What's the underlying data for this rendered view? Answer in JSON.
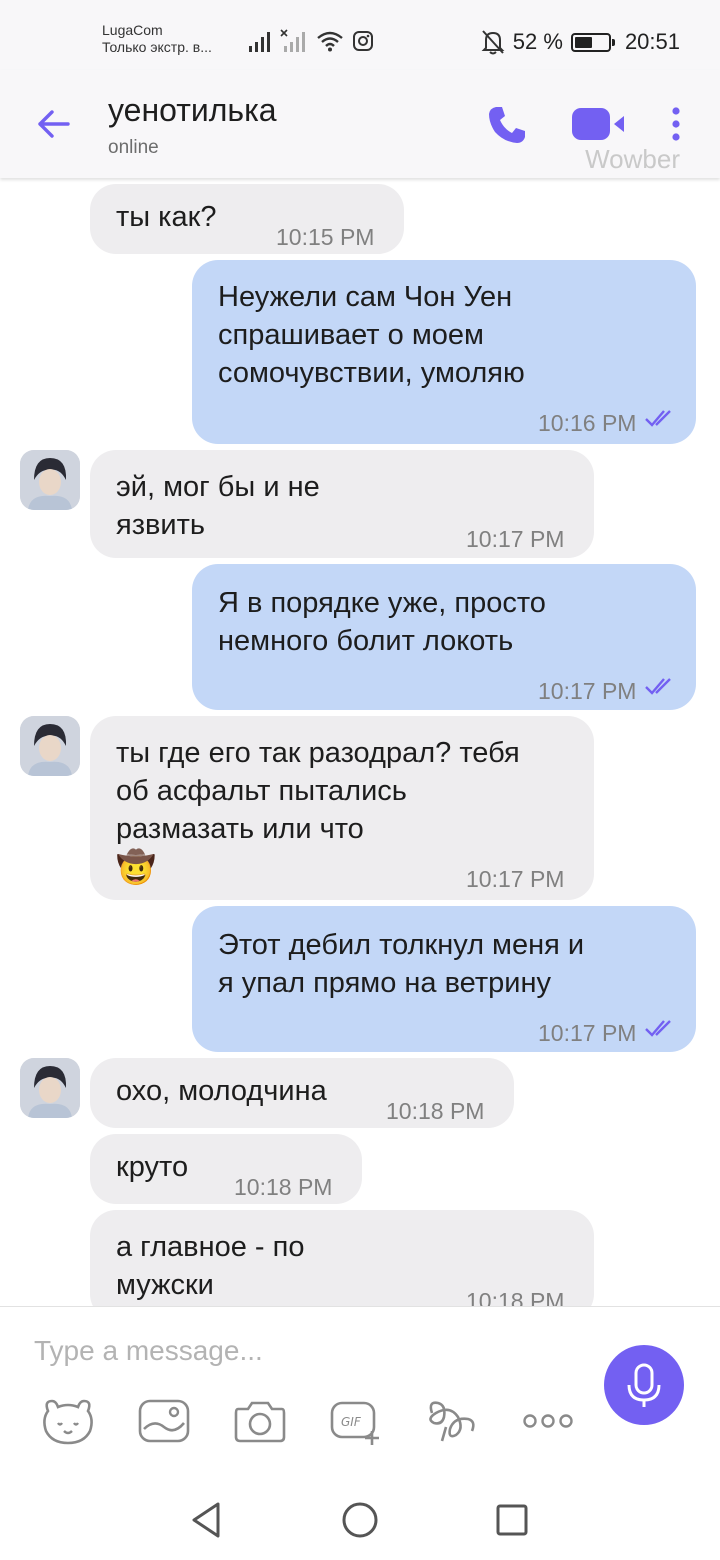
{
  "status_bar": {
    "carrier": "LugaCom",
    "carrier_sub": "Только экстр. в...",
    "battery_text": "52 %",
    "battery_level": 0.52,
    "time": "20:51"
  },
  "header": {
    "back_icon": "arrow-left-icon",
    "name": "уенотилька",
    "status": "online",
    "watermark": "Wowber",
    "accent_color": "#7360f2"
  },
  "messages": [
    {
      "dir": "in",
      "text": "ты как?",
      "time": "10:15 PM"
    },
    {
      "dir": "out",
      "text": "Неужели сам Чон Уен спрашивает о моем сомочувствии, умоляю",
      "time": "10:16 PM"
    },
    {
      "dir": "in",
      "text": "эй, мог бы и не язвить",
      "time": "10:17 PM"
    },
    {
      "dir": "out",
      "text": "Я в порядке уже, просто немного болит локоть",
      "time": "10:17 PM"
    },
    {
      "dir": "in",
      "text": "ты где его так разодрал? тебя об асфальт пытались размазать или что",
      "emoji": "🤠",
      "time": "10:17 PM"
    },
    {
      "dir": "out",
      "text": "Этот дебил толкнул меня и я упал прямо на ветрину",
      "time": "10:17 PM"
    },
    {
      "dir": "in",
      "text": "охо, молодчина",
      "time": "10:18 PM"
    },
    {
      "dir": "in",
      "text": "круто",
      "time": "10:18 PM"
    },
    {
      "dir": "in",
      "text": "а главное - по мужски",
      "time": "10:18 PM"
    }
  ],
  "composer": {
    "placeholder": "Type a message...",
    "mic_icon": "microphone-icon",
    "tools": [
      "sticker-icon",
      "gallery-icon",
      "camera-icon",
      "gif-icon",
      "doodle-icon",
      "more-icon"
    ]
  },
  "nav": {
    "buttons": [
      "back-triangle-icon",
      "home-circle-icon",
      "recents-square-icon"
    ]
  }
}
